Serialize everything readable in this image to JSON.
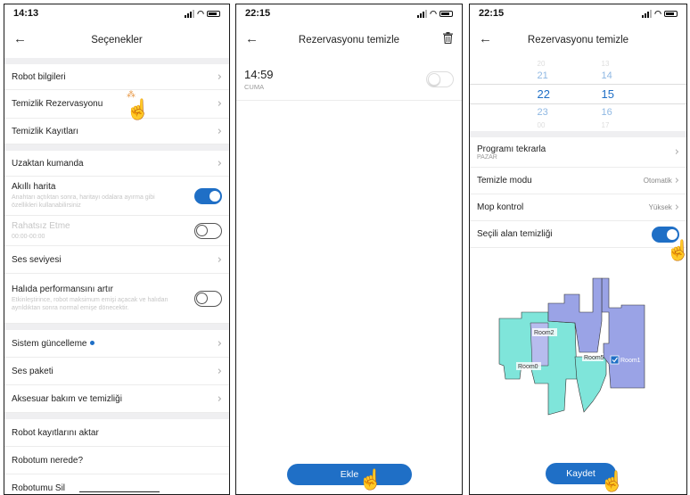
{
  "screen1": {
    "time": "14:13",
    "title": "Seçenekler",
    "rows": {
      "robot_info": "Robot bilgileri",
      "clean_reservation": "Temizlik Rezervasyonu",
      "clean_logs": "Temizlik Kayıtları",
      "remote": "Uzaktan kumanda",
      "smart_map": "Akıllı harita",
      "smart_map_desc": "Anahtarı açtıktan sonra, haritayı odalara ayırma gibi özellikleri kullanabilirsiniz",
      "dnd": "Rahatsız Etme",
      "dnd_time": "00:00-00:00",
      "volume": "Ses seviyesi",
      "carpet": "Halıda performansını artır",
      "carpet_desc": "Etkinleştirince, robot maksimum emişi açacak ve halıdan ayrıldıktan sonra normal emişe dönecektir.",
      "system_update": "Sistem güncelleme",
      "voice_pack": "Ses paketi",
      "accessory": "Aksesuar bakım ve temizliği",
      "export_logs": "Robot kayıtlarını aktar",
      "find_robot": "Robotum nerede?",
      "delete_robot": "Robotumu Sil"
    },
    "toggles": {
      "smart_map": true,
      "dnd": false,
      "carpet": false
    }
  },
  "screen2": {
    "time": "22:15",
    "title": "Rezervasyonu temizle",
    "schedule_time": "14:59",
    "schedule_day": "CUMA",
    "schedule_enabled": false,
    "add_button": "Ekle"
  },
  "screen3": {
    "time": "22:15",
    "title": "Rezervasyonu temizle",
    "picker_hours": [
      "20",
      "21",
      "22",
      "23",
      "00"
    ],
    "picker_minutes": [
      "13",
      "14",
      "15",
      "16",
      "17"
    ],
    "repeat_label": "Programı tekrarla",
    "repeat_value": "PAZAR",
    "mode_label": "Temizle modu",
    "mode_value": "Otomatik",
    "mop_label": "Mop kontrol",
    "mop_value": "Yüksek",
    "area_label": "Seçili alan temizliği",
    "area_enabled": true,
    "map_rooms": [
      "Room2",
      "Room5",
      "Room0",
      "Room1"
    ],
    "save_button": "Kaydet"
  },
  "colors": {
    "accent": "#1f6fc6",
    "map_teal": "#7fe5da",
    "map_purple": "#9aa3e6"
  }
}
